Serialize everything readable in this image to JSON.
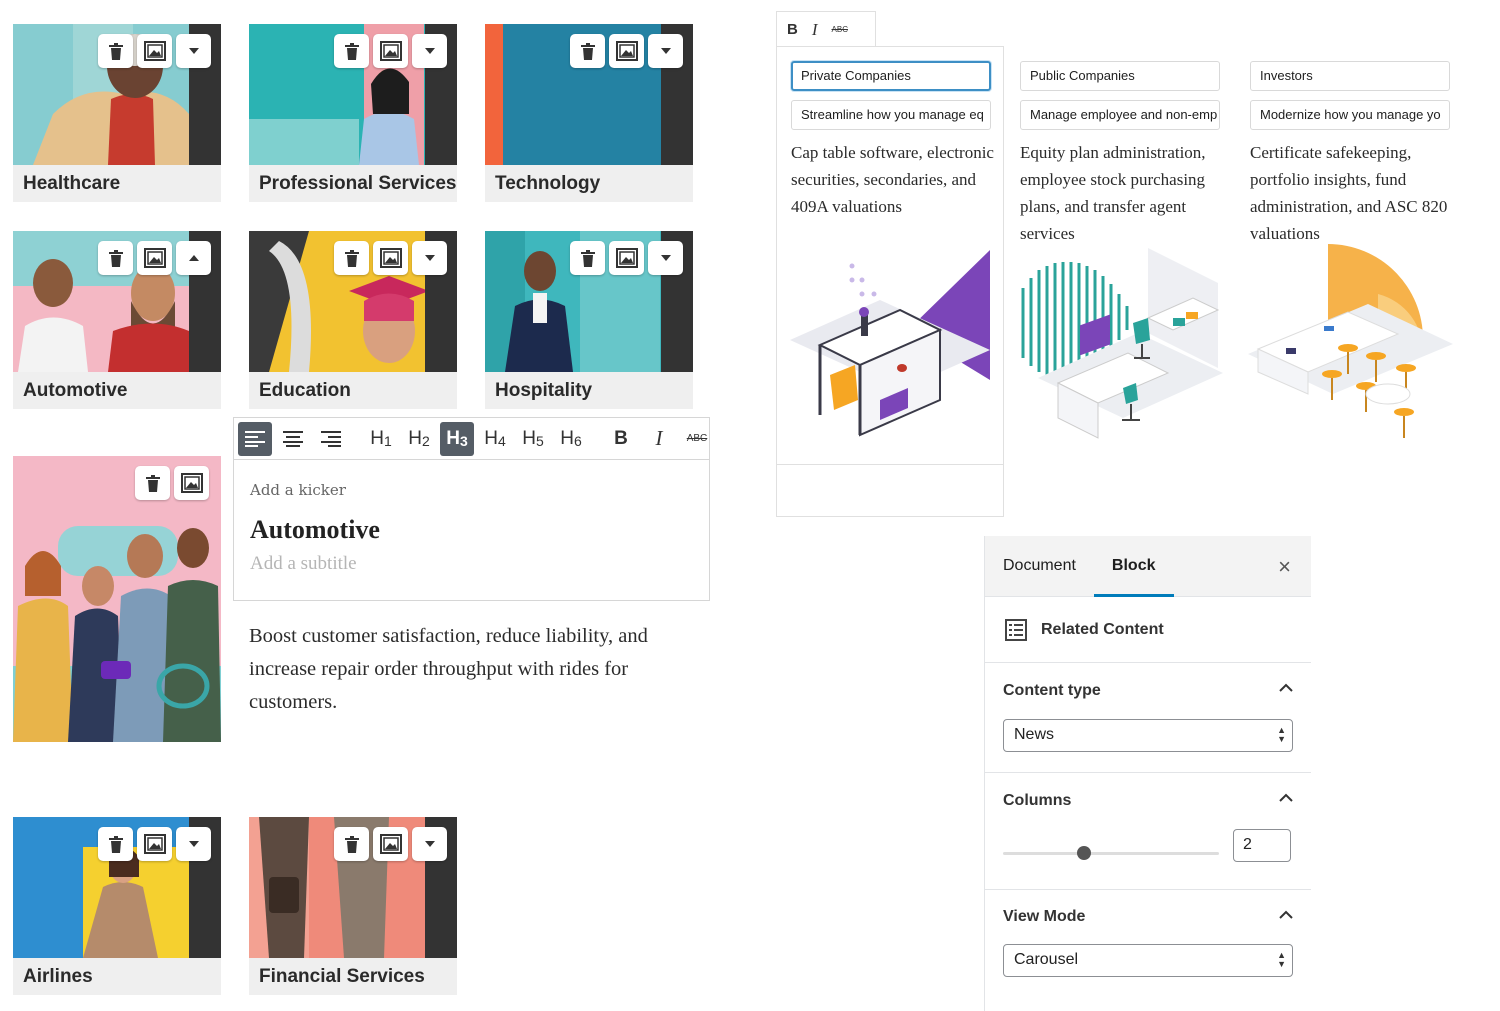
{
  "cards": [
    {
      "caption": "Healthcare",
      "expanded": false
    },
    {
      "caption": "Professional Services",
      "expanded": false
    },
    {
      "caption": "Technology",
      "expanded": false
    },
    {
      "caption": "Automotive",
      "expanded": true
    },
    {
      "caption": "Education",
      "expanded": false
    },
    {
      "caption": "Hospitality",
      "expanded": false
    },
    {
      "caption": "Airlines",
      "expanded": false
    },
    {
      "caption": "Financial Services",
      "expanded": false
    }
  ],
  "toolbar": {
    "h1": "H",
    "h1_sub": "1",
    "h2": "H",
    "h2_sub": "2",
    "h3": "H",
    "h3_sub": "3",
    "h4": "H",
    "h4_sub": "4",
    "h5": "H",
    "h5_sub": "5",
    "h6": "H",
    "h6_sub": "6",
    "bold": "B",
    "italic": "I",
    "strike": "ABC",
    "active_heading": "H3"
  },
  "editor": {
    "kicker_placeholder": "Add a kicker",
    "heading": "Automotive",
    "subtitle_placeholder": "Add a subtitle",
    "body": "Boost customer satisfaction, reduce liability, and increase repair order throughput with rides for customers."
  },
  "companies": [
    {
      "title": "Private Companies",
      "summary": "Streamline how you manage eq",
      "description": "Cap table software, electronic securities, secondaries, and 409A valuations"
    },
    {
      "title": "Public Companies",
      "summary": "Manage employee and non-emp",
      "description": "Equity plan administration, employee stock purchasing plans, and transfer agent services"
    },
    {
      "title": "Investors",
      "summary": "Modernize how you manage yo",
      "description": "Certificate safekeeping, portfolio insights, fund administration, and ASC 820 valuations"
    }
  ],
  "sidebar": {
    "tab_document": "Document",
    "tab_block": "Block",
    "close_symbol": "×",
    "block_name": "Related Content",
    "content_type_title": "Content type",
    "content_type_value": "News",
    "columns_title": "Columns",
    "columns_value": "2",
    "view_mode_title": "View Mode",
    "view_mode_value": "Carousel"
  },
  "colors": {
    "accent": "#007cba",
    "caption_bg": "#efefef",
    "focus_border": "#3d8fc5",
    "purple": "#7b45b8",
    "teal": "#2aa39a",
    "orange": "#f6a623"
  }
}
